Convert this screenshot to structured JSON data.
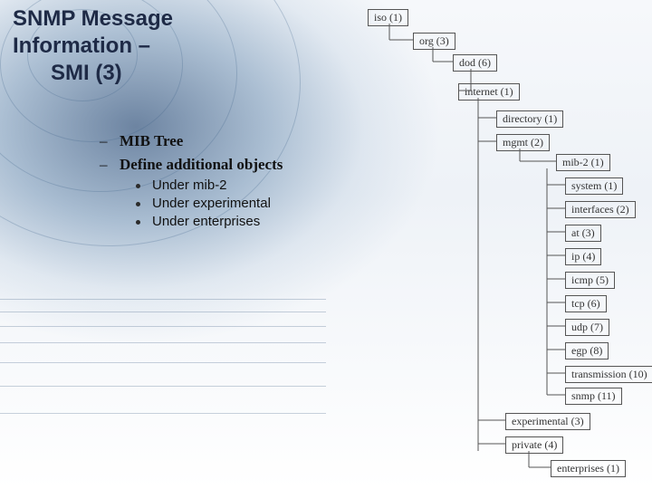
{
  "title": {
    "line1": "SNMP Message",
    "line2": "Information –",
    "line3": "SMI (3)"
  },
  "content": {
    "item1": "MIB Tree",
    "item2": "Define additional objects",
    "sub1": "Under mib-2",
    "sub2": "Under experimental",
    "sub3": "Under enterprises"
  },
  "tree": {
    "iso": "iso (1)",
    "org": "org (3)",
    "dod": "dod (6)",
    "internet": "internet (1)",
    "directory": "directory (1)",
    "mgmt": "mgmt (2)",
    "mib2": "mib-2 (1)",
    "system": "system (1)",
    "interfaces": "interfaces (2)",
    "at": "at (3)",
    "ip": "ip (4)",
    "icmp": "icmp (5)",
    "tcp": "tcp (6)",
    "udp": "udp (7)",
    "egp": "egp (8)",
    "transmission": "transmission (10)",
    "snmp": "snmp (11)",
    "experimental": "experimental (3)",
    "private": "private (4)",
    "enterprises": "enterprises (1)"
  }
}
